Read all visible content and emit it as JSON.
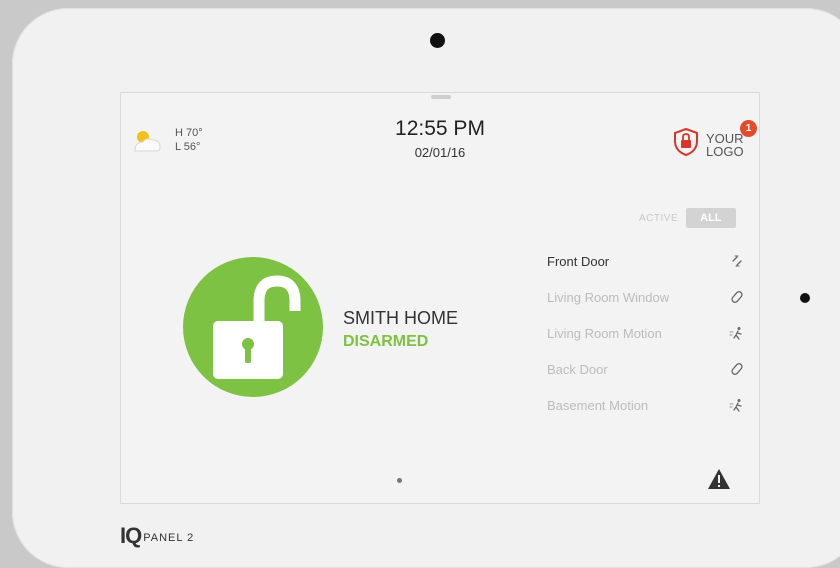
{
  "weather": {
    "high": "H 70°",
    "low": "L 56°",
    "icon": "partly-sunny-icon"
  },
  "clock": {
    "time": "12:55 PM",
    "date": "02/01/16"
  },
  "logo": {
    "line1": "YOUR",
    "line2": "LOGO",
    "notification_count": "1",
    "icon": "shield-lock-icon"
  },
  "filter": {
    "active_label": "ACTIVE",
    "all_label": "ALL"
  },
  "system": {
    "name": "SMITH HOME",
    "status": "DISARMED",
    "status_color": "#7dc242",
    "icon": "unlocked-padlock-icon"
  },
  "sensors": [
    {
      "name": "Front Door",
      "icon": "door-open-icon"
    },
    {
      "name": "Living Room Window",
      "icon": "contact-sensor-icon"
    },
    {
      "name": "Living Room Motion",
      "icon": "motion-sensor-icon"
    },
    {
      "name": "Back Door",
      "icon": "contact-sensor-icon"
    },
    {
      "name": "Basement Motion",
      "icon": "motion-sensor-icon"
    }
  ],
  "device": {
    "brand": "IQ",
    "model": "PANEL 2"
  }
}
